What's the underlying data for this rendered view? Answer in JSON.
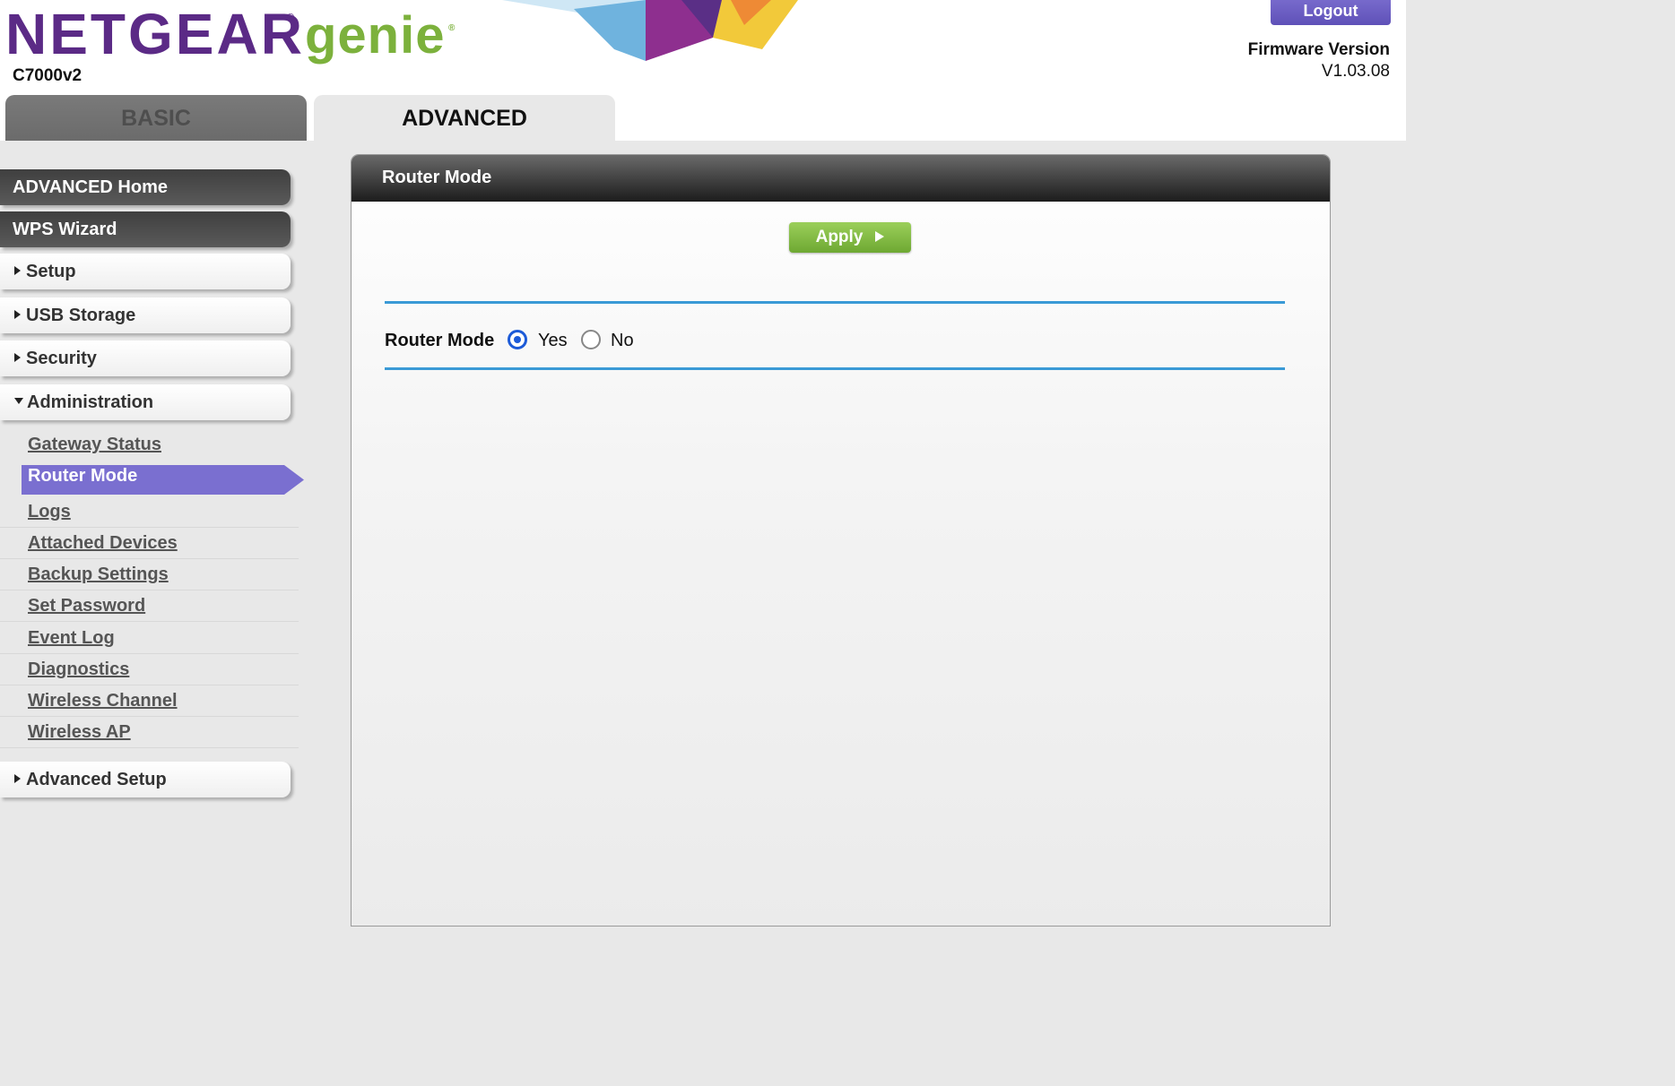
{
  "header": {
    "brand_primary": "NETGEAR",
    "brand_secondary": "genie",
    "registered_mark": "®",
    "model": "C7000v2",
    "logout_label": "Logout",
    "firmware_label": "Firmware Version",
    "firmware_version": "V1.03.08"
  },
  "tabs": [
    {
      "label": "BASIC",
      "active": false
    },
    {
      "label": "ADVANCED",
      "active": true
    }
  ],
  "sidebar": {
    "top_buttons": [
      {
        "label": "ADVANCED Home"
      },
      {
        "label": "WPS Wizard"
      }
    ],
    "sections": [
      {
        "label": "Setup",
        "expanded": false
      },
      {
        "label": "USB Storage",
        "expanded": false
      },
      {
        "label": "Security",
        "expanded": false
      },
      {
        "label": "Administration",
        "expanded": true
      }
    ],
    "admin_items": [
      "Gateway Status",
      "Router Mode",
      "Logs",
      "Attached Devices",
      "Backup Settings",
      "Set Password",
      "Event Log",
      "Diagnostics",
      "Wireless Channel",
      "Wireless AP"
    ],
    "selected_item": "Router Mode",
    "bottom_section": {
      "label": "Advanced Setup",
      "expanded": false
    }
  },
  "main": {
    "title": "Router Mode",
    "apply_label": "Apply",
    "setting_label": "Router Mode",
    "options": [
      {
        "label": "Yes",
        "selected": true
      },
      {
        "label": "No",
        "selected": false
      }
    ]
  },
  "colors": {
    "brand_purple": "#5b2a86",
    "brand_green": "#7cb13c",
    "selected_item": "#7a6fd0",
    "divider_blue": "#3a9ad6",
    "apply_green": "#7cb842"
  }
}
